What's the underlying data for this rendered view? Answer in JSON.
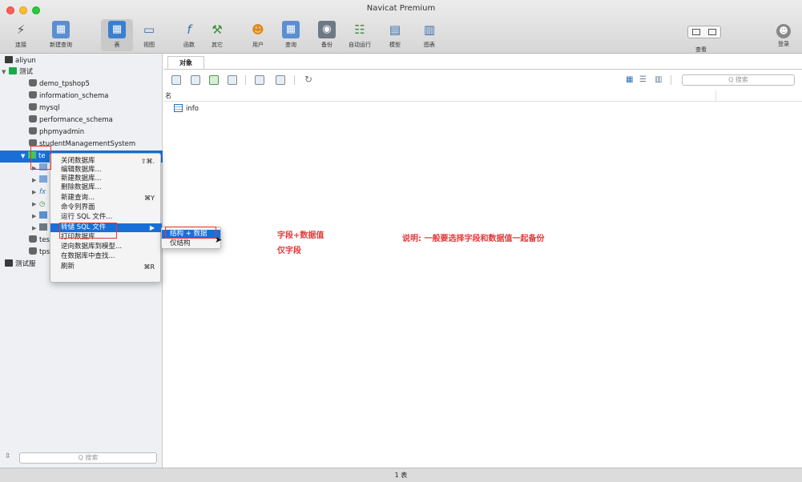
{
  "window": {
    "title": "Navicat Premium"
  },
  "toolbar": [
    {
      "label": "连接",
      "icon": "connection-icon"
    },
    {
      "label": "新建查询",
      "icon": "new-query-icon"
    },
    {
      "label": "表",
      "icon": "table-icon",
      "active": true
    },
    {
      "label": "视图",
      "icon": "view-icon"
    },
    {
      "label": "函数",
      "icon": "function-icon"
    },
    {
      "label": "其它",
      "icon": "other-icon"
    },
    {
      "label": "用户",
      "icon": "user-icon"
    },
    {
      "label": "查询",
      "icon": "query-icon"
    },
    {
      "label": "备份",
      "icon": "backup-icon"
    },
    {
      "label": "自动运行",
      "icon": "automation-icon"
    },
    {
      "label": "模型",
      "icon": "model-icon"
    },
    {
      "label": "图表",
      "icon": "chart-icon"
    }
  ],
  "toolbar_right": {
    "view_label": "查看",
    "login_label": "登录"
  },
  "sidebar": {
    "connections": [
      "aliyun",
      "测试"
    ],
    "databases": [
      "demo_tpshop5",
      "information_schema",
      "mysql",
      "performance_schema",
      "phpmyadmin",
      "studentManagementSystem"
    ],
    "selected_db_partial": "te",
    "extra_rows": [
      "tes",
      "tps"
    ],
    "extra_connection": "测试服",
    "function_glyph": "fx",
    "search_placeholder": "Q 搜索"
  },
  "main": {
    "tab_label": "对象",
    "column_name": "名",
    "table_name": "info",
    "search_placeholder": "Q 搜索"
  },
  "context_menu": [
    {
      "label": "关闭数据库",
      "shortcut": "⇧⌘."
    },
    {
      "label": "编辑数据库...",
      "shortcut": ""
    },
    {
      "label": "新建数据库...",
      "shortcut": ""
    },
    {
      "label": "删除数据库...",
      "shortcut": ""
    },
    {
      "label": "新建查询...",
      "shortcut": "⌘Y"
    },
    {
      "label": "命令列界面",
      "shortcut": ""
    },
    {
      "label": "运行 SQL 文件...",
      "shortcut": ""
    },
    {
      "label": "转储 SQL 文件",
      "shortcut": "▶",
      "highlight": true
    },
    {
      "label": "打印数据库...",
      "shortcut": ""
    },
    {
      "label": "逆向数据库到模型...",
      "shortcut": ""
    },
    {
      "label": "在数据库中查找...",
      "shortcut": ""
    },
    {
      "label": "刷新",
      "shortcut": "⌘R"
    }
  ],
  "submenu": [
    {
      "label": "结构 + 数据",
      "highlight": true
    },
    {
      "label": "仅结构",
      "highlight": false
    }
  ],
  "annotations": {
    "note_line1": "字段+数据值",
    "note_line2": "仅字段",
    "note_right": "说明: 一般要选择字段和数据值一起备份"
  },
  "statusbar": {
    "text": "1 表"
  },
  "colors": {
    "selection": "#1a6fd6",
    "annotation_red": "#e23a3a"
  }
}
